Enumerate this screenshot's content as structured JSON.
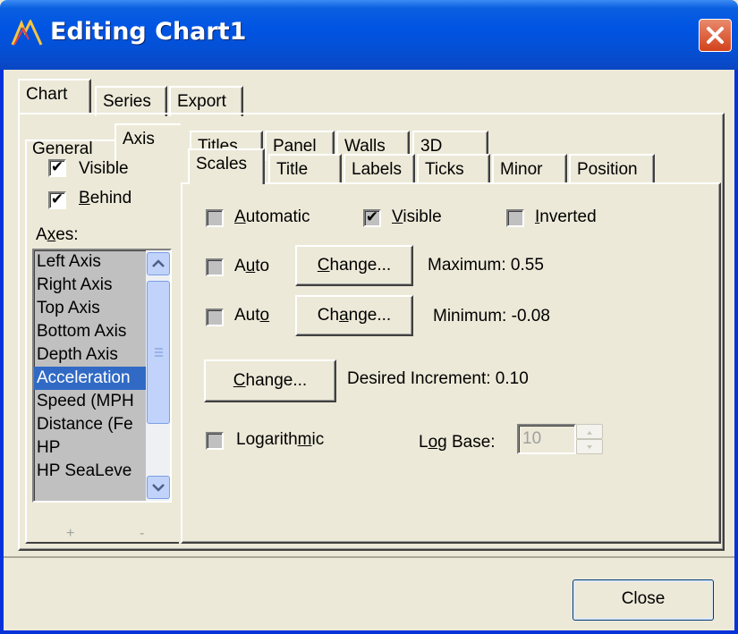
{
  "window": {
    "title": "Editing Chart1",
    "close_glyph": "✕"
  },
  "main_tabs": [
    "Chart",
    "Series",
    "Export"
  ],
  "chart_tabs": [
    "General",
    "Axis",
    "Titles",
    "Panel",
    "Walls",
    "3D"
  ],
  "axis_tabs": [
    "Scales",
    "Title",
    "Labels",
    "Ticks",
    "Minor",
    "Position"
  ],
  "left": {
    "visible_label": "Visible",
    "behind_label": "Behind",
    "axes_label": "Axes:",
    "axes": [
      "Left Axis",
      "Right Axis",
      "Top Axis",
      "Bottom Axis",
      "Depth Axis",
      "Acceleration",
      "Speed (MPH",
      "Distance (Fe",
      "HP",
      "HP SeaLeve"
    ],
    "selected_axis": "Acceleration",
    "add_label": "+",
    "remove_label": "-"
  },
  "scales": {
    "automatic_label": "Automatic",
    "visible_label": "Visible",
    "inverted_label": "Inverted",
    "auto_max_label": "Auto",
    "auto_min_label": "Auto",
    "change_label": "Change...",
    "maximum_label": "Maximum:",
    "maximum_value": "0.55",
    "minimum_label": "Minimum:",
    "minimum_value": "-0.08",
    "increment_label": "Desired Increment:",
    "increment_value": "0.10",
    "logarithmic_label": "Logarithmic",
    "logbase_label": "Log Base:",
    "logbase_value": "10"
  },
  "footer": {
    "close_label": "Close"
  },
  "colors": {
    "title_bar": "#0054e3",
    "selection": "#316ac5",
    "face": "#ece9d8"
  }
}
